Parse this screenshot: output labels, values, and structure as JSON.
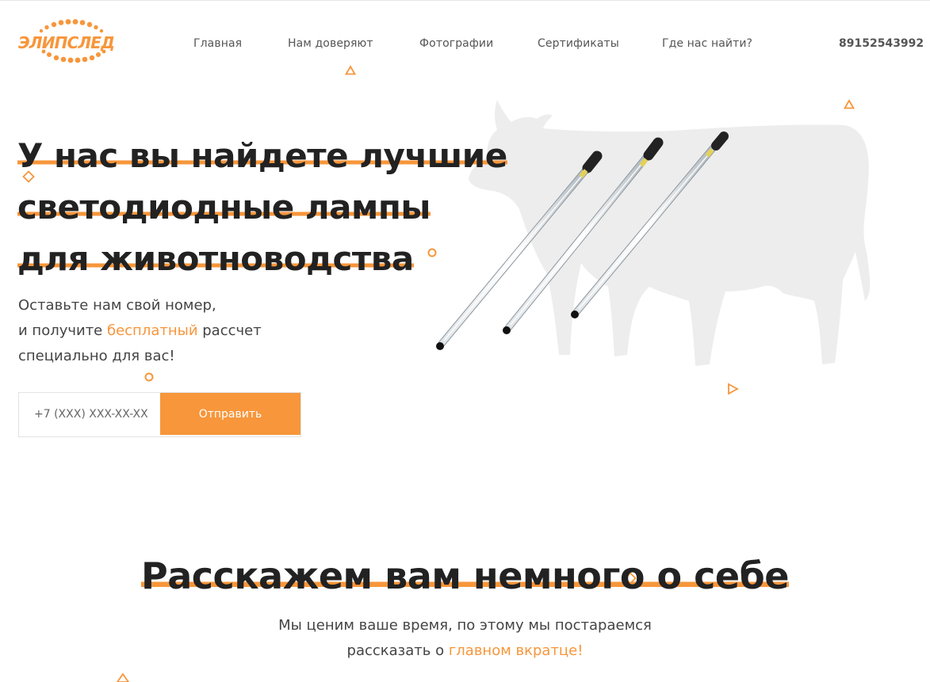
{
  "brand": {
    "logo_text": "ЭЛИПСЛЕД",
    "accent_color": "#f7963b"
  },
  "nav": {
    "items": [
      {
        "label": "Главная"
      },
      {
        "label": "Нам доверяют"
      },
      {
        "label": "Фотографии"
      },
      {
        "label": "Сертификаты"
      },
      {
        "label": "Где нас найти?"
      }
    ],
    "phone": "89152543992"
  },
  "hero": {
    "title_lines": [
      "У нас вы найдете лучшие",
      "светодиодные лампы",
      "для животноводства"
    ],
    "subtitle": {
      "line1": "Оставьте нам свой номер,",
      "line2_before": "и получите ",
      "line2_accent": "бесплатный",
      "line2_after": " рассчет",
      "line3": "специально для вас!"
    },
    "phone_input": {
      "placeholder": "+7 (XXX) XXX-XX-XX",
      "value": ""
    },
    "submit_label": "Отправить",
    "image": "cow-silhouette-with-led-tube-lamps"
  },
  "about": {
    "title": "Расскажем вам немного о себе",
    "subtitle": {
      "line1": "Мы ценим ваше время, по этому мы постараемся",
      "line2_before": "рассказать о ",
      "line2_accent": "главном вкратце!"
    }
  },
  "decorations": {
    "icons": [
      "triangle-outline-icon",
      "diamond-outline-icon",
      "circle-outline-icon"
    ]
  }
}
